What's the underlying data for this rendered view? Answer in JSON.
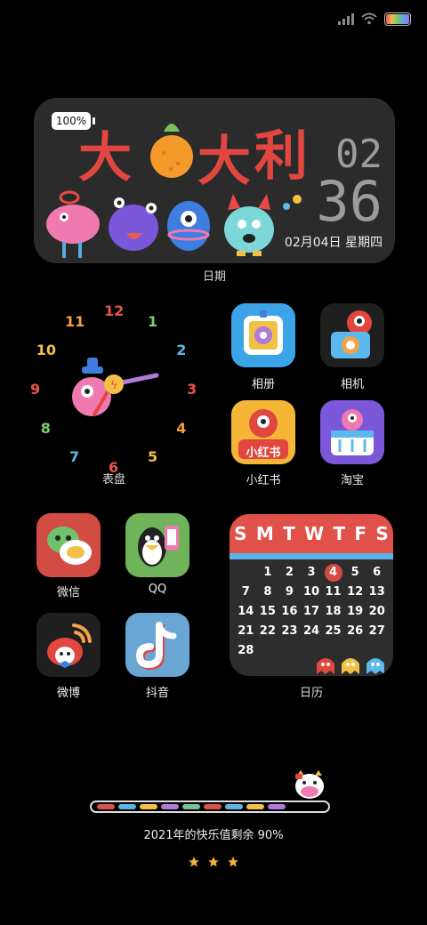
{
  "date_widget": {
    "battery_label": "100%",
    "title_chars": [
      "大",
      "大",
      "利"
    ],
    "hour": "02",
    "minute": "36",
    "date": "02月04日 星期四",
    "label": "日期"
  },
  "clock_widget": {
    "numbers": [
      "12",
      "1",
      "2",
      "3",
      "4",
      "5",
      "6",
      "7",
      "8",
      "9",
      "10",
      "11"
    ],
    "number_colors": [
      "#e8534c",
      "#7ad06c",
      "#5cb9ee",
      "#e8534c",
      "#f2a245",
      "#f2c044",
      "#e8534c",
      "#5cb9ee",
      "#7ad06c",
      "#e8534c",
      "#f2c044",
      "#f2a245"
    ],
    "label": "表盘"
  },
  "apps": [
    {
      "label": "相册",
      "icon": "photo-album-icon",
      "bg": "#3da3e8"
    },
    {
      "label": "相机",
      "icon": "camera-icon",
      "bg": "#1f1f1f"
    },
    {
      "label": "小红书",
      "icon": "xiaohongshu-icon",
      "bg": "#f5b637",
      "badge": "小红书"
    },
    {
      "label": "淘宝",
      "icon": "taobao-icon",
      "bg": "#7b57d9"
    },
    {
      "label": "微信",
      "icon": "wechat-icon",
      "bg": "#d34c43"
    },
    {
      "label": "QQ",
      "icon": "qq-icon",
      "bg": "#6fb45a"
    },
    {
      "label": "微博",
      "icon": "weibo-icon",
      "bg": "#1f1f1f"
    },
    {
      "label": "抖音",
      "icon": "douyin-icon",
      "bg": "#6aa6d3"
    }
  ],
  "calendar": {
    "weekdays": [
      "S",
      "M",
      "T",
      "W",
      "T",
      "F",
      "S"
    ],
    "days": [
      "",
      "1",
      "2",
      "3",
      "4",
      "5",
      "6",
      "7",
      "8",
      "9",
      "10",
      "11",
      "12",
      "13",
      "14",
      "15",
      "16",
      "17",
      "18",
      "19",
      "20",
      "21",
      "22",
      "23",
      "24",
      "25",
      "26",
      "27",
      "28"
    ],
    "today": "4",
    "label": "日历"
  },
  "progress": {
    "text": "2021年的快乐值剩余 90%",
    "remaining": 0.9,
    "segment_colors": [
      "#d9534c",
      "#5cb3e6",
      "#f2c044",
      "#b07ad9",
      "#6fc29a",
      "#d9534c",
      "#5cb3e6",
      "#f2c044",
      "#b07ad9"
    ]
  },
  "stars": 3
}
